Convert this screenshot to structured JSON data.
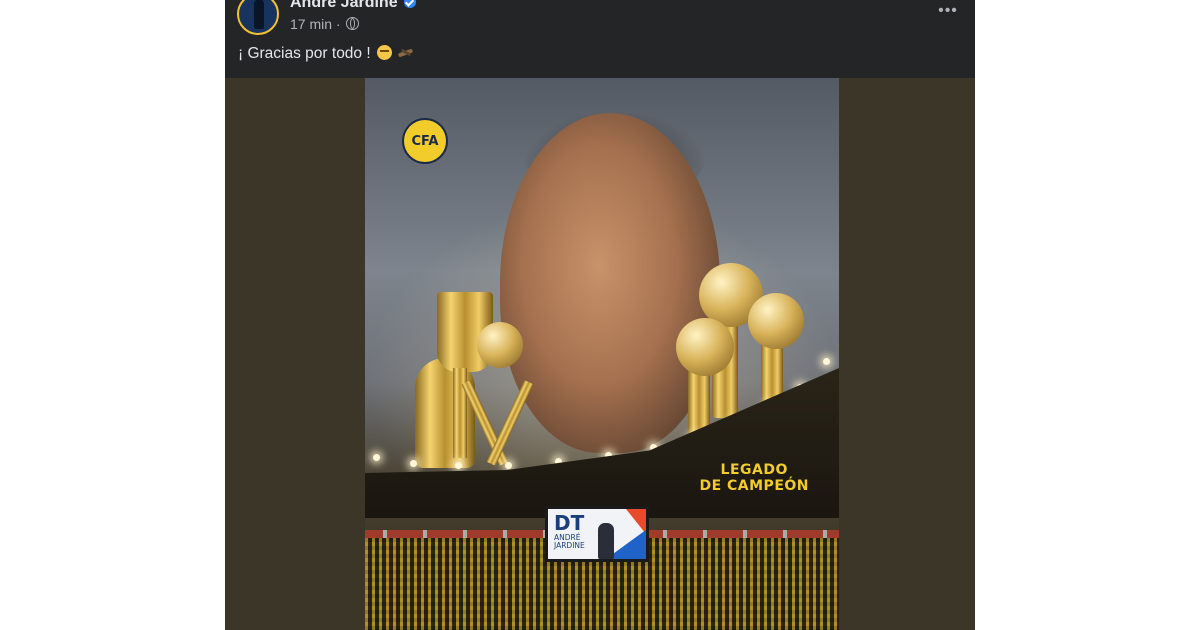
{
  "post": {
    "author": "Andre Jardine",
    "time": "17 min",
    "separator": "·",
    "text": "¡ Gracias por todo !",
    "more": "•••"
  },
  "image": {
    "banner_line1": "LEGADO",
    "banner_line2": "DE CAMPEÓN",
    "screen_title": "DT",
    "screen_name_line1": "ANDRÉ",
    "screen_name_line2": "JARDINE",
    "club_logo": "CFA"
  },
  "icons": {
    "verified": "verified-badge-icon",
    "audience": "globe-icon",
    "more": "more-options-icon"
  },
  "colors": {
    "card_bg": "#242526",
    "text": "#e4e6eb",
    "muted": "#b0b3b8",
    "verified": "#2d88ff",
    "accent_gold": "#f2cc2a"
  }
}
